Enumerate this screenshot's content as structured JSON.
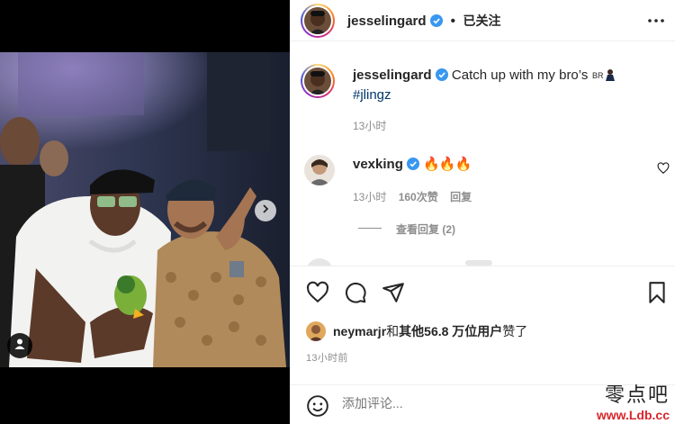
{
  "post": {
    "author": "jesselingard",
    "follow_status": "已关注",
    "separator": "•",
    "caption": {
      "text": "Catch up with my bro’s",
      "hashtag": "#jlingz",
      "time": "13小时"
    }
  },
  "comments": [
    {
      "user": "vexking",
      "text": "🔥🔥🔥",
      "time": "13小时",
      "likes": "160次赞",
      "reply_label": "回复",
      "view_replies": "查看回复 (2)"
    }
  ],
  "likes": {
    "user": "neymarjr",
    "joiner": "和",
    "others_label": "其他56.8 万位用户",
    "suffix": "赞了"
  },
  "posted_ago": "13小时前",
  "comment_box": {
    "placeholder": "添加评论..."
  },
  "watermark": {
    "top": "零点吧",
    "bottom": "www.Ldb.cc"
  },
  "icons": {
    "more": "more-horizontal-icon",
    "like": "heart-icon",
    "comment": "comment-bubble-icon",
    "share": "paper-plane-icon",
    "save": "bookmark-icon",
    "emoji": "smiley-icon",
    "next": "chevron-right-icon",
    "tag": "person-tag-icon"
  },
  "colors": {
    "verified": "#3897f0",
    "hashtag": "#00376b",
    "muted": "#8e8e8e",
    "fire": "#f36b1c"
  }
}
